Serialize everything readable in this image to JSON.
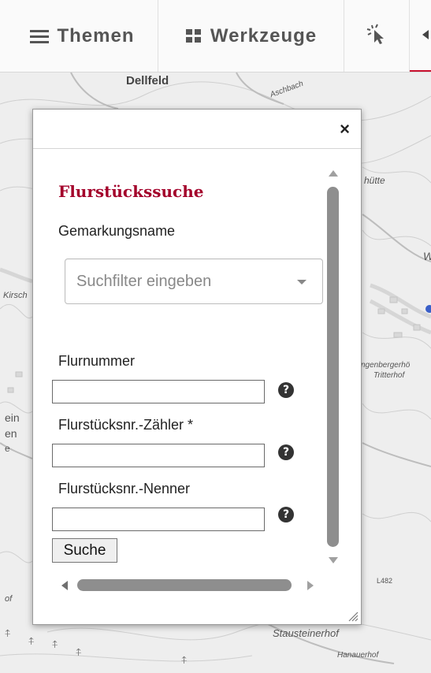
{
  "nav": {
    "themen_label": "Themen",
    "werkzeuge_label": "Werkzeuge"
  },
  "map": {
    "labels": {
      "dellfeld": "Dellfeld",
      "aschbach": "Aschbach",
      "huette": "hütte",
      "kirsch": "Kirsch",
      "ein": "ein",
      "en": "en",
      "e": "e",
      "langenberger": "ngenbergerhö",
      "tritterhof": "Tritterhof",
      "l482": "L482",
      "of": "of",
      "stausteinerhof": "Stausteinerhof",
      "hanauerhof": "Hanauerhof",
      "w": "W"
    }
  },
  "dialog": {
    "close_symbol": "×",
    "title": "Flurstückssuche",
    "gemarkung": {
      "label": "Gemarkungsname",
      "placeholder": "Suchfilter eingeben"
    },
    "flurnummer": {
      "label": "Flurnummer",
      "value": ""
    },
    "zaehler": {
      "label": "Flurstücksnr.-Zähler *",
      "value": ""
    },
    "nenner": {
      "label": "Flurstücksnr.-Nenner",
      "value": ""
    },
    "help_symbol": "?",
    "search_button": "Suche"
  },
  "colors": {
    "title": "#a3002a",
    "active_tab_underline": "#c8102e"
  }
}
